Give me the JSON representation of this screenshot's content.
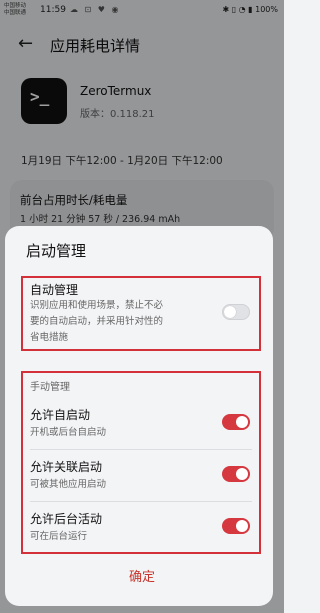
{
  "status_bar": {
    "carrier_1": "中国移动",
    "carrier_2": "中国联通",
    "time": "11:59",
    "icons": "☁ ⊡ ♥ ◉",
    "battery": "100%",
    "right_icons": "✱ ▯ ◔ ▮"
  },
  "header": {
    "title": "应用耗电详情"
  },
  "app": {
    "name": "ZeroTermux",
    "version": "版本：0.118.21",
    "icon_glyph": ">_"
  },
  "date_range": "1月19日 下午12:00 - 1月20日 下午12:00",
  "usage_card": {
    "title": "前台占用时长/耗电量",
    "value": "1 小时 21 分钟 57 秒 / 236.94 mAh"
  },
  "dialog": {
    "title": "启动管理",
    "auto": {
      "title": "自动管理",
      "desc_line1": "识别应用和使用场景，禁止不必",
      "desc_line2": "要的自动启动，并采用针对性的",
      "desc_line3": "省电措施",
      "enabled": false
    },
    "manual": {
      "section_label": "手动管理",
      "items": [
        {
          "title": "允许自启动",
          "sub": "开机或后台自启动",
          "enabled": true
        },
        {
          "title": "允许关联启动",
          "sub": "可被其他应用启动",
          "enabled": true
        },
        {
          "title": "允许后台活动",
          "sub": "可在后台运行",
          "enabled": true
        }
      ]
    },
    "confirm_label": "确定"
  },
  "colors": {
    "accent": "#d6383f",
    "highlight_box": "#d3303a",
    "confirm_text": "#c7352c"
  }
}
